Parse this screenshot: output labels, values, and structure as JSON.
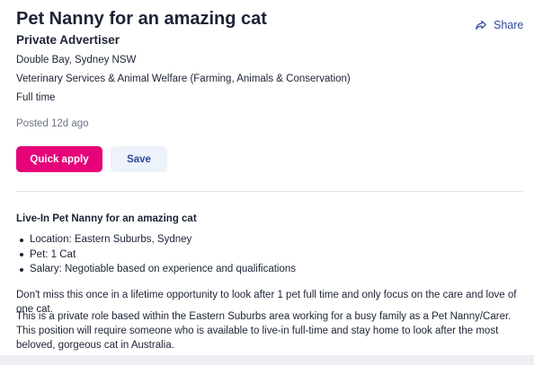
{
  "job": {
    "title": "Pet Nanny for an amazing cat",
    "advertiser": "Private Advertiser",
    "location": "Double Bay, Sydney NSW",
    "classification": "Veterinary Services & Animal Welfare (Farming, Animals & Conservation)",
    "work_type": "Full time",
    "posted": "Posted 12d ago"
  },
  "actions": {
    "share_label": "Share",
    "share_icon": "share-arrow-icon",
    "quick_apply_label": "Quick apply",
    "save_label": "Save"
  },
  "description": {
    "heading": "Live-In Pet Nanny for an amazing cat",
    "bullets": [
      "Location: Eastern Suburbs, Sydney",
      "Pet: 1 Cat",
      "Salary: Negotiable based on experience and qualifications"
    ],
    "paragraphs": [
      "Don't miss this once in a lifetime opportunity to look after 1 pet full time and only focus on the care and love of one cat.",
      "This is a private role based within the Eastern Suburbs area working for a busy family as a Pet Nanny/Carer. This position will require someone who is available to live-in full-time and stay home to look after the most beloved, gorgeous cat in Australia."
    ]
  },
  "colors": {
    "primary_brand": "#e60278",
    "link_blue": "#2e4b9c",
    "text": "#1c2335",
    "muted_text": "#6b7388",
    "save_bg": "#eef2fa"
  }
}
